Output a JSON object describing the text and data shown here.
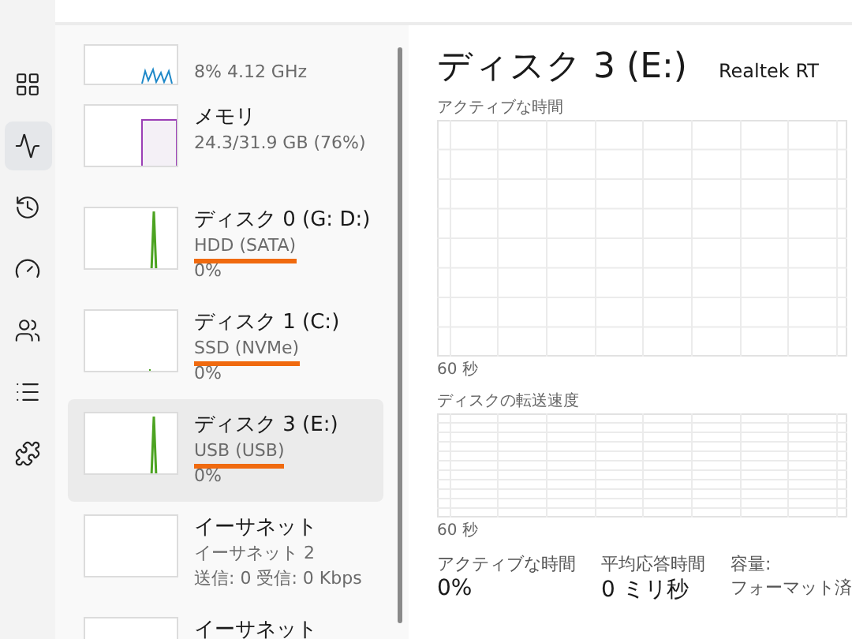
{
  "nav": [
    {
      "kind": "processes",
      "selected": false
    },
    {
      "kind": "performance",
      "selected": true
    },
    {
      "kind": "history",
      "selected": false
    },
    {
      "kind": "startup",
      "selected": false
    },
    {
      "kind": "users",
      "selected": false
    },
    {
      "kind": "details",
      "selected": false
    },
    {
      "kind": "services",
      "selected": false
    }
  ],
  "devices": [
    {
      "kind": "cpu",
      "lines": [
        "8%  4.12 GHz"
      ],
      "selected": false
    },
    {
      "kind": "memory",
      "title": "メモリ",
      "lines": [
        "24.3/31.9 GB (76%)"
      ],
      "selected": false
    },
    {
      "kind": "disk",
      "title": "ディスク 0 (G: D:)",
      "lines": [
        "HDD (SATA)",
        "0%"
      ],
      "selected": false,
      "marked": true
    },
    {
      "kind": "disk-idle",
      "title": "ディスク 1 (C:)",
      "lines": [
        "SSD (NVMe)",
        "0%"
      ],
      "selected": false,
      "marked": true
    },
    {
      "kind": "disk",
      "title": "ディスク 3 (E:)",
      "lines": [
        "USB (USB)",
        "0%"
      ],
      "selected": true,
      "marked": true
    },
    {
      "kind": "network",
      "title": "イーサネット",
      "lines": [
        "イーサネット 2",
        "送信: 0 受信: 0 Kbps"
      ],
      "selected": false
    },
    {
      "kind": "network",
      "title": "イーサネット",
      "selected": false
    }
  ],
  "detail": {
    "title": "ディスク 3 (E:)",
    "model": "Realtek RT",
    "charts": [
      {
        "label": "アクティブな時間",
        "span": "60 秒"
      },
      {
        "label": "ディスクの転送速度",
        "span": "60 秒"
      }
    ],
    "stats": [
      {
        "label": "アクティブな時間",
        "value": "0%"
      },
      {
        "label": "平均応答時間",
        "value": "0 ミリ秒"
      },
      {
        "label": "容量:",
        "value": "フォーマット済"
      }
    ]
  }
}
